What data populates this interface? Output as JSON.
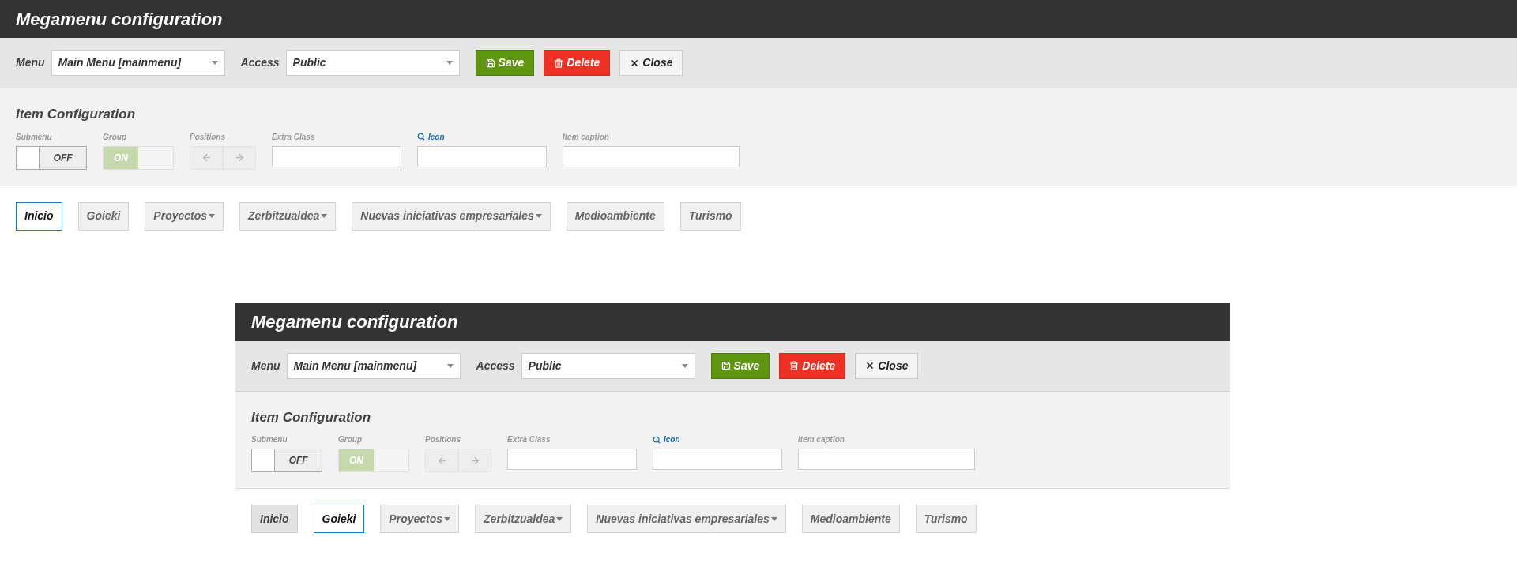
{
  "panels": [
    {
      "title": "Megamenu configuration",
      "toolbar": {
        "fields": [
          {
            "label": "Menu",
            "value": "Main Menu [mainmenu]"
          },
          {
            "label": "Access",
            "value": "Public"
          }
        ],
        "buttons": [
          {
            "kind": "save",
            "label": "Save"
          },
          {
            "kind": "delete",
            "label": "Delete"
          },
          {
            "kind": "close",
            "label": "Close"
          }
        ]
      },
      "config": {
        "title": "Item Configuration",
        "toggles": [
          {
            "label": "Submenu",
            "on": false,
            "text": "OFF"
          },
          {
            "label": "Group",
            "on": true,
            "text": "ON"
          }
        ],
        "positions": {
          "label": "Positions",
          "disabled": true
        },
        "inputs": [
          {
            "label": "Extra Class",
            "kind": "text"
          },
          {
            "label": "Icon",
            "kind": "icon"
          },
          {
            "label": "Item caption",
            "kind": "caption"
          }
        ]
      },
      "menu_items": [
        {
          "label": "Inicio",
          "selected": true,
          "active": false,
          "dropdown": false
        },
        {
          "label": "Goieki",
          "selected": false,
          "active": false,
          "dropdown": false
        },
        {
          "label": "Proyectos",
          "selected": false,
          "active": false,
          "dropdown": true
        },
        {
          "label": "Zerbitzualdea",
          "selected": false,
          "active": false,
          "dropdown": true
        },
        {
          "label": "Nuevas iniciativas empresariales",
          "selected": false,
          "active": false,
          "dropdown": true
        },
        {
          "label": "Medioambiente",
          "selected": false,
          "active": false,
          "dropdown": false
        },
        {
          "label": "Turismo",
          "selected": false,
          "active": false,
          "dropdown": false
        }
      ]
    },
    {
      "title": "Megamenu configuration",
      "toolbar": {
        "fields": [
          {
            "label": "Menu",
            "value": "Main Menu [mainmenu]"
          },
          {
            "label": "Access",
            "value": "Public"
          }
        ],
        "buttons": [
          {
            "kind": "save",
            "label": "Save"
          },
          {
            "kind": "delete",
            "label": "Delete"
          },
          {
            "kind": "close",
            "label": "Close"
          }
        ]
      },
      "config": {
        "title": "Item Configuration",
        "toggles": [
          {
            "label": "Submenu",
            "on": false,
            "text": "OFF"
          },
          {
            "label": "Group",
            "on": true,
            "text": "ON"
          }
        ],
        "positions": {
          "label": "Positions",
          "disabled": true
        },
        "inputs": [
          {
            "label": "Extra Class",
            "kind": "text"
          },
          {
            "label": "Icon",
            "kind": "icon"
          },
          {
            "label": "Item caption",
            "kind": "caption"
          }
        ]
      },
      "menu_items": [
        {
          "label": "Inicio",
          "selected": false,
          "active": true,
          "dropdown": false
        },
        {
          "label": "Goieki",
          "selected": true,
          "active": false,
          "dropdown": false
        },
        {
          "label": "Proyectos",
          "selected": false,
          "active": false,
          "dropdown": true
        },
        {
          "label": "Zerbitzualdea",
          "selected": false,
          "active": false,
          "dropdown": true
        },
        {
          "label": "Nuevas iniciativas empresariales",
          "selected": false,
          "active": false,
          "dropdown": true
        },
        {
          "label": "Medioambiente",
          "selected": false,
          "active": false,
          "dropdown": false
        },
        {
          "label": "Turismo",
          "selected": false,
          "active": false,
          "dropdown": false
        }
      ]
    }
  ]
}
